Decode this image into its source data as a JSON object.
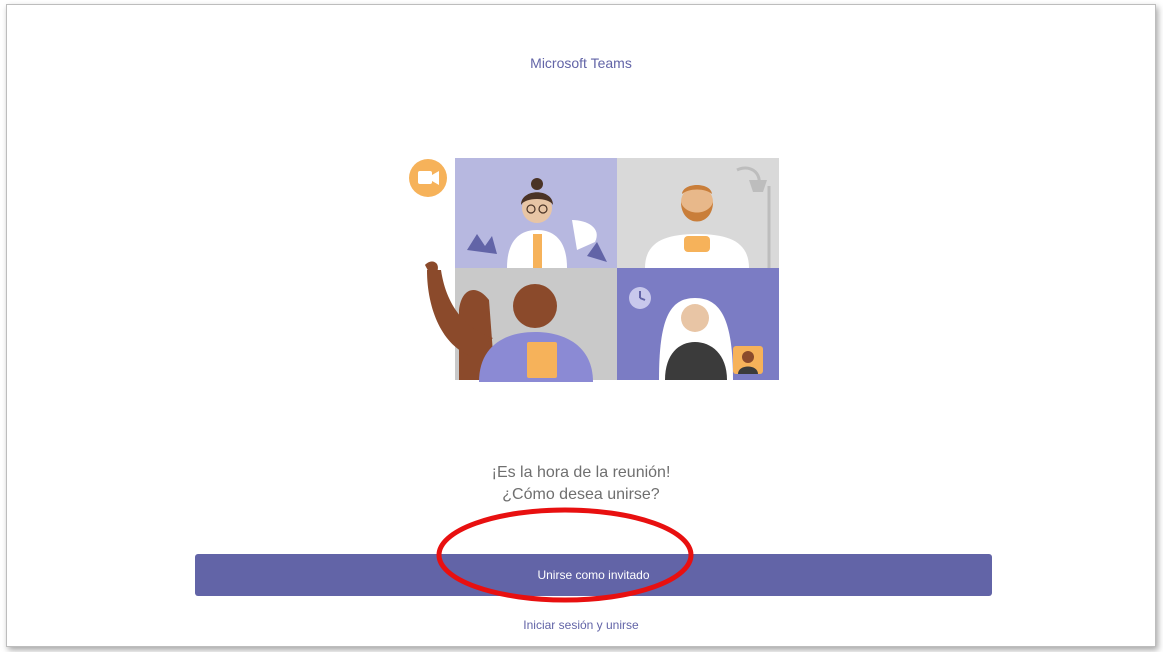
{
  "app": {
    "title": "Microsoft Teams"
  },
  "prompt": {
    "line1": "¡Es la hora de la reunión!",
    "line2": "¿Cómo desea unirse?"
  },
  "actions": {
    "join_as_guest_label": "Unirse como invitado",
    "sign_in_label": "Iniciar sesión y unirse"
  },
  "colors": {
    "brand": "#6264a7",
    "highlight": "#e81010",
    "accent_orange": "#f6b25a"
  },
  "icons": [
    "video-camera-icon",
    "clock-icon"
  ]
}
